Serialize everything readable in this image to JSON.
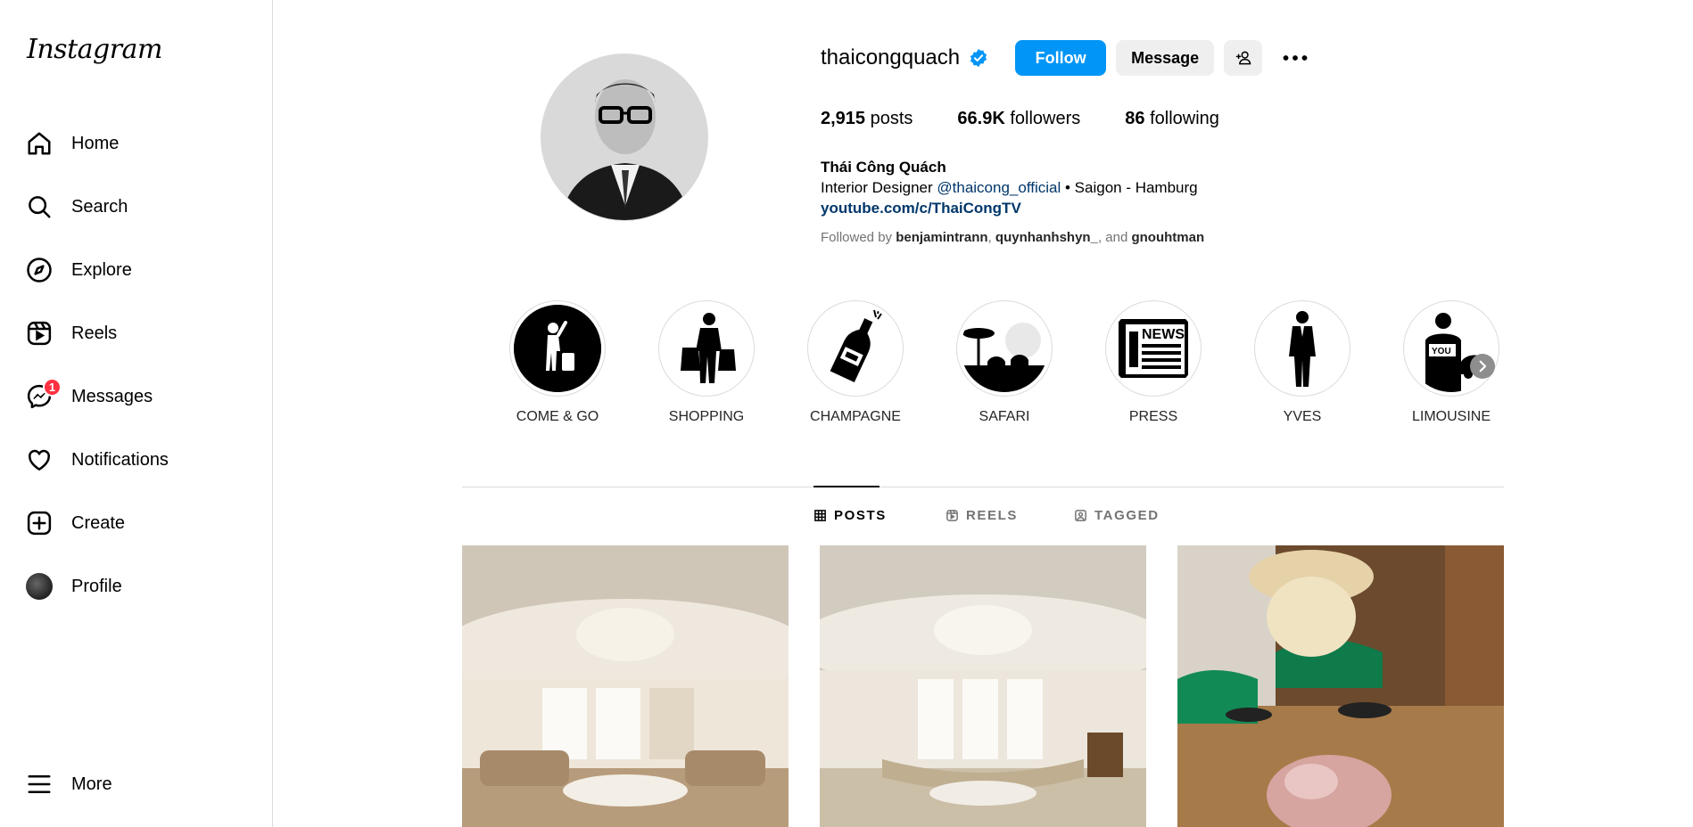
{
  "app": {
    "logo_text": "Instagram"
  },
  "sidebar": {
    "items": [
      {
        "label": "Home",
        "icon": "home-icon"
      },
      {
        "label": "Search",
        "icon": "search-icon"
      },
      {
        "label": "Explore",
        "icon": "compass-icon"
      },
      {
        "label": "Reels",
        "icon": "reels-icon"
      },
      {
        "label": "Messages",
        "icon": "messenger-icon",
        "badge": "1"
      },
      {
        "label": "Notifications",
        "icon": "heart-icon"
      },
      {
        "label": "Create",
        "icon": "plus-square-icon"
      },
      {
        "label": "Profile",
        "icon": "avatar"
      }
    ],
    "more_label": "More"
  },
  "profile": {
    "username": "thaicongquach",
    "verified": true,
    "follow_label": "Follow",
    "message_label": "Message",
    "stats": {
      "posts_value": "2,915",
      "posts_label": " posts",
      "followers_value": "66.9K",
      "followers_label": " followers",
      "following_value": "86",
      "following_label": " following"
    },
    "bio": {
      "name": "Thái Công Quách",
      "line1_prefix": "Interior Designer ",
      "mention": "@thaicong_official",
      "line1_suffix": " • Saigon - Hamburg",
      "link": "youtube.com/c/ThaiCongTV"
    },
    "followed_by": {
      "prefix": "Followed by ",
      "user1": "benjamintrann",
      "sep1": ", ",
      "user2": "quynhanhshyn_",
      "sep2": ", and ",
      "user3": "gnouhtman"
    }
  },
  "highlights": [
    {
      "label": "COME & GO"
    },
    {
      "label": "SHOPPING"
    },
    {
      "label": "CHAMPAGNE"
    },
    {
      "label": "SAFARI"
    },
    {
      "label": "PRESS"
    },
    {
      "label": "YVES"
    },
    {
      "label": "LIMOUSINE"
    }
  ],
  "highlight_icons": {
    "news_text": "NEWS",
    "you_text": "YOU"
  },
  "tabs": [
    {
      "label": "POSTS",
      "icon": "grid-icon",
      "active": true
    },
    {
      "label": "REELS",
      "icon": "reels-icon",
      "active": false
    },
    {
      "label": "TAGGED",
      "icon": "tag-icon",
      "active": false
    }
  ],
  "colors": {
    "accent": "#0095f6",
    "badge": "#ff3040",
    "link": "#00376b"
  }
}
